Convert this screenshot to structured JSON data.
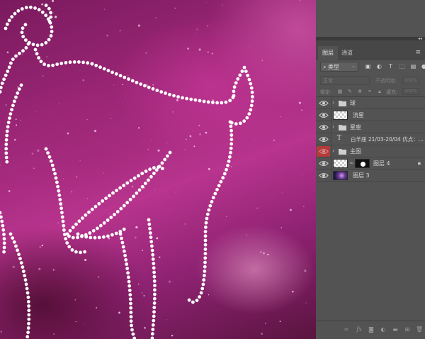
{
  "panel": {
    "tabs": [
      {
        "label": "图层",
        "active": true
      },
      {
        "label": "通道",
        "active": false
      }
    ],
    "filter": {
      "kind_label": "类型"
    },
    "blend_mode": "正常",
    "opacity_label": "不透明度:",
    "opacity_value": "100%",
    "lock_label": "锁定:",
    "fill_label": "填充:",
    "fill_value": "100%"
  },
  "layers": [
    {
      "name": "球",
      "type": "group",
      "visible": true,
      "collapsed": true
    },
    {
      "name": "流星",
      "type": "pixel",
      "visible": true
    },
    {
      "name": "星座",
      "type": "group",
      "visible": true,
      "collapsed": true
    },
    {
      "name": "白羊座 21/03-20/04  优点：...",
      "type": "text",
      "visible": true
    },
    {
      "name": "主图",
      "type": "group",
      "visible": false,
      "collapsed": true
    },
    {
      "name": "图层 4",
      "type": "pixel-masked",
      "visible": true,
      "locked": true
    },
    {
      "name": "图层 3",
      "type": "pixel",
      "visible": true
    }
  ],
  "icons": {
    "panel_menu": "hamburger-icon",
    "visibility": "eye-icon",
    "group": "folder-icon",
    "text_layer": "type-icon",
    "link": "chain-link-icon",
    "lock": "lock-icon"
  },
  "colors": {
    "panel_bg": "#535353",
    "hidden_layer_highlight": "#b53b3b",
    "artwork_pink": "#b8348e"
  }
}
